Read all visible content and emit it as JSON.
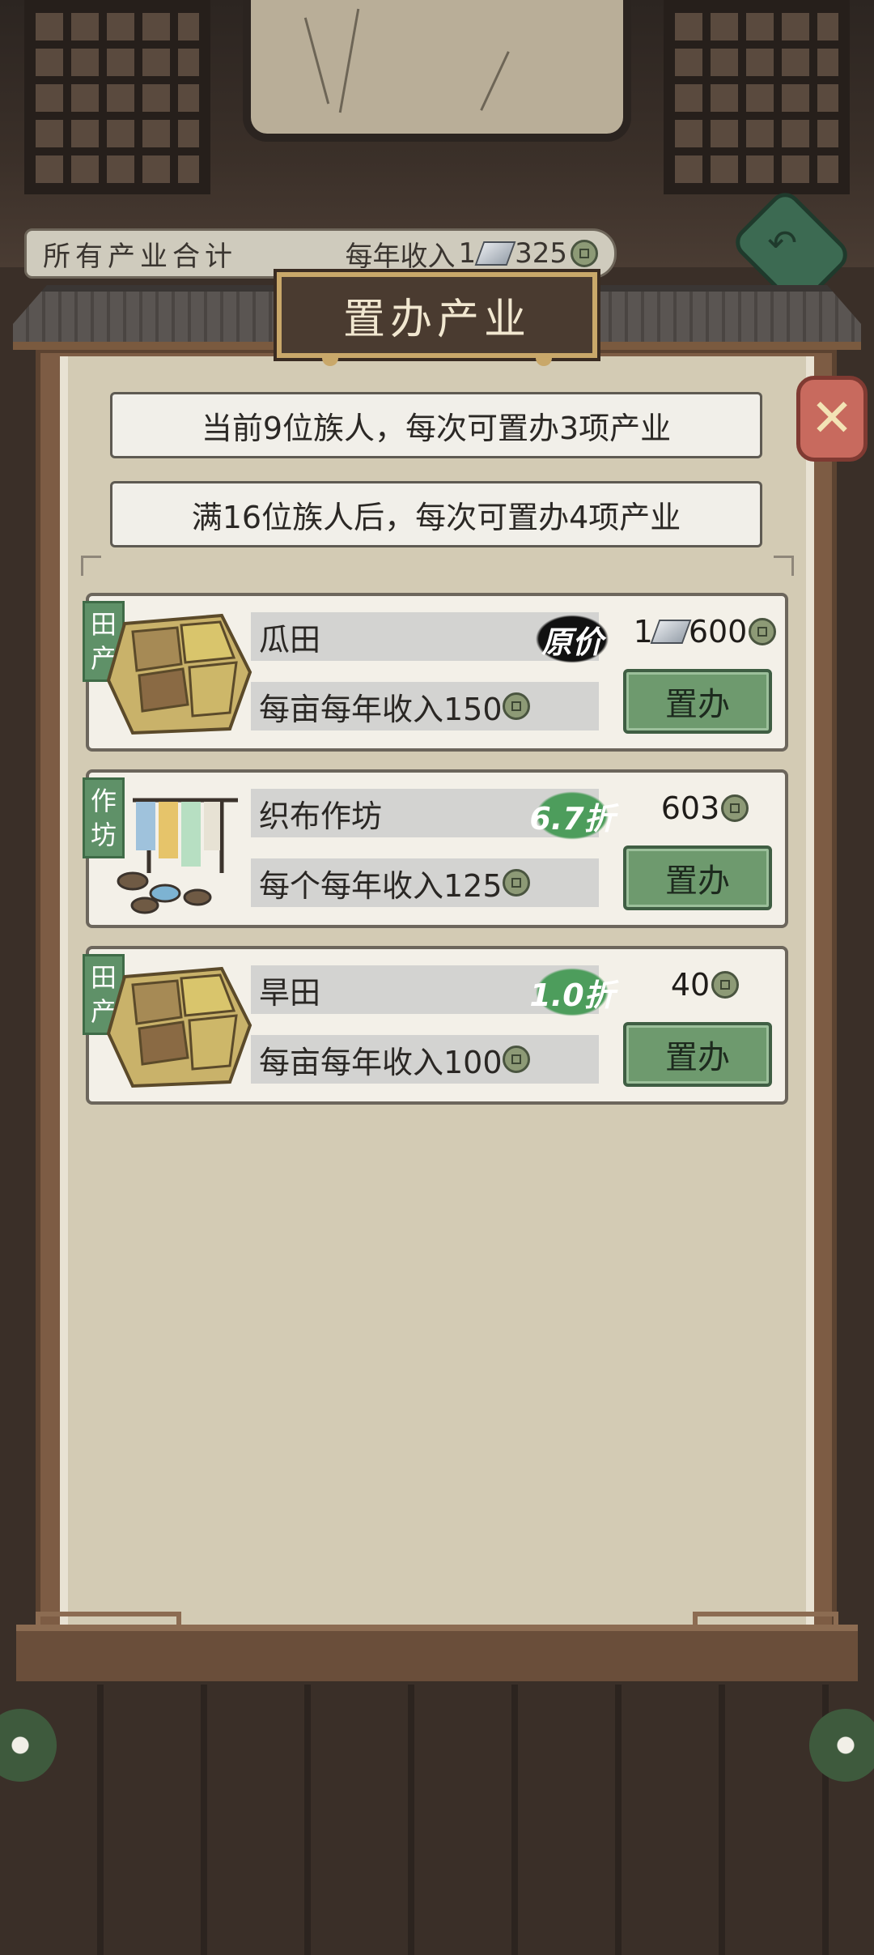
{
  "summary": {
    "label": "所有产业合计",
    "income_prefix": "每年收入",
    "silver_amount": "1",
    "coin_amount": "325"
  },
  "dialog": {
    "title": "置办产业",
    "info_current": "当前9位族人，每次可置办3项产业",
    "info_next": "满16位族人后，每次可置办4项产业"
  },
  "properties": [
    {
      "category": "田产",
      "name": "瓜田",
      "income": "每亩每年收入150",
      "discount": "原价",
      "price_silver": "1",
      "price_coins": "600",
      "buy_label": "置办",
      "image": "field-icon"
    },
    {
      "category": "作坊",
      "name": "织布作坊",
      "income": "每个每年收入125",
      "discount": "6.7折",
      "price_silver": "",
      "price_coins": "603",
      "buy_label": "置办",
      "image": "workshop-icon"
    },
    {
      "category": "田产",
      "name": "旱田",
      "income": "每亩每年收入100",
      "discount": "1.0折",
      "price_silver": "",
      "price_coins": "40",
      "buy_label": "置办",
      "image": "field-icon"
    }
  ],
  "colors": {
    "panel_bg": "#d3cbb4",
    "card_bg": "#f3f0e8",
    "button_green": "#6e9a6e",
    "tag_green": "#5f9168",
    "title_plaque": "#4a3b30",
    "close_red": "#c86a5e"
  }
}
